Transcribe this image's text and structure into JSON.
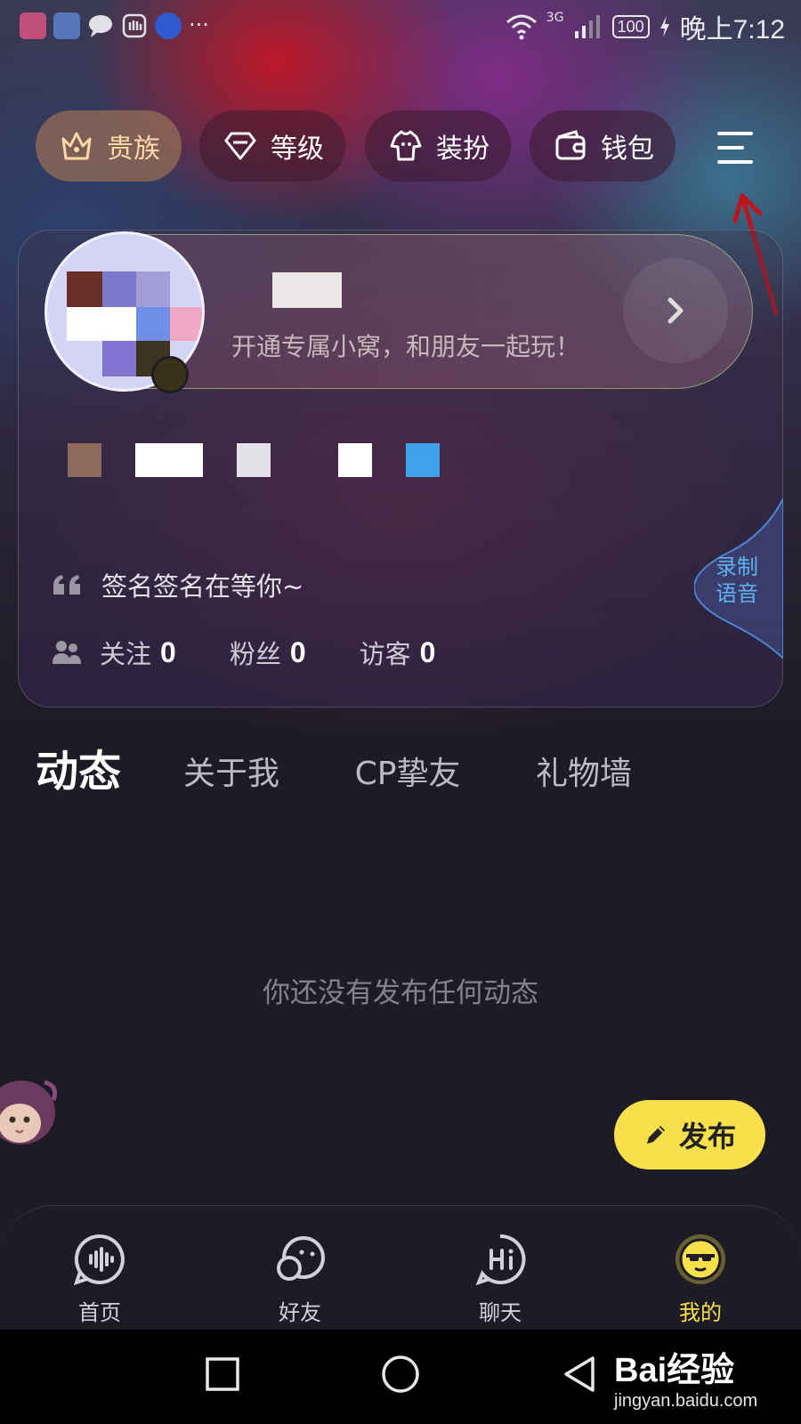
{
  "status_bar": {
    "battery": "100",
    "network": "3G",
    "time": "晚上7:12",
    "more": "···"
  },
  "top_buttons": [
    {
      "label": "贵族",
      "icon": "crown-icon"
    },
    {
      "label": "等级",
      "icon": "gem-icon"
    },
    {
      "label": "装扮",
      "icon": "outfit-icon"
    },
    {
      "label": "钱包",
      "icon": "wallet-icon"
    }
  ],
  "profile": {
    "banner_text": "开通专属小窝，和朋友一起玩！",
    "signature": "签名签名在等你~",
    "voice_tab": [
      "录制",
      "语音"
    ],
    "stats": [
      {
        "label": "关注",
        "value": "0"
      },
      {
        "label": "粉丝",
        "value": "0"
      },
      {
        "label": "访客",
        "value": "0"
      }
    ]
  },
  "tabs": [
    {
      "label": "动态",
      "active": true
    },
    {
      "label": "关于我",
      "active": false
    },
    {
      "label": "CP挚友",
      "active": false
    },
    {
      "label": "礼物墙",
      "active": false
    }
  ],
  "empty_text": "你还没有发布任何动态",
  "publish_label": "发布",
  "bottom_nav": [
    {
      "label": "首页",
      "icon": "home-voice-icon",
      "active": false
    },
    {
      "label": "好友",
      "icon": "friends-icon",
      "active": false
    },
    {
      "label": "聊天",
      "icon": "chat-hi-icon",
      "active": false
    },
    {
      "label": "我的",
      "icon": "me-icon",
      "active": true
    }
  ],
  "watermark": {
    "main": "Bai经验",
    "sub": "jingyan.baidu.com"
  },
  "colors": {
    "accent_yellow": "#f7e04c",
    "voice_blue": "#5fb2f2",
    "noble_gold": "#ffd9a8",
    "annotation_red": "#c0141c"
  }
}
